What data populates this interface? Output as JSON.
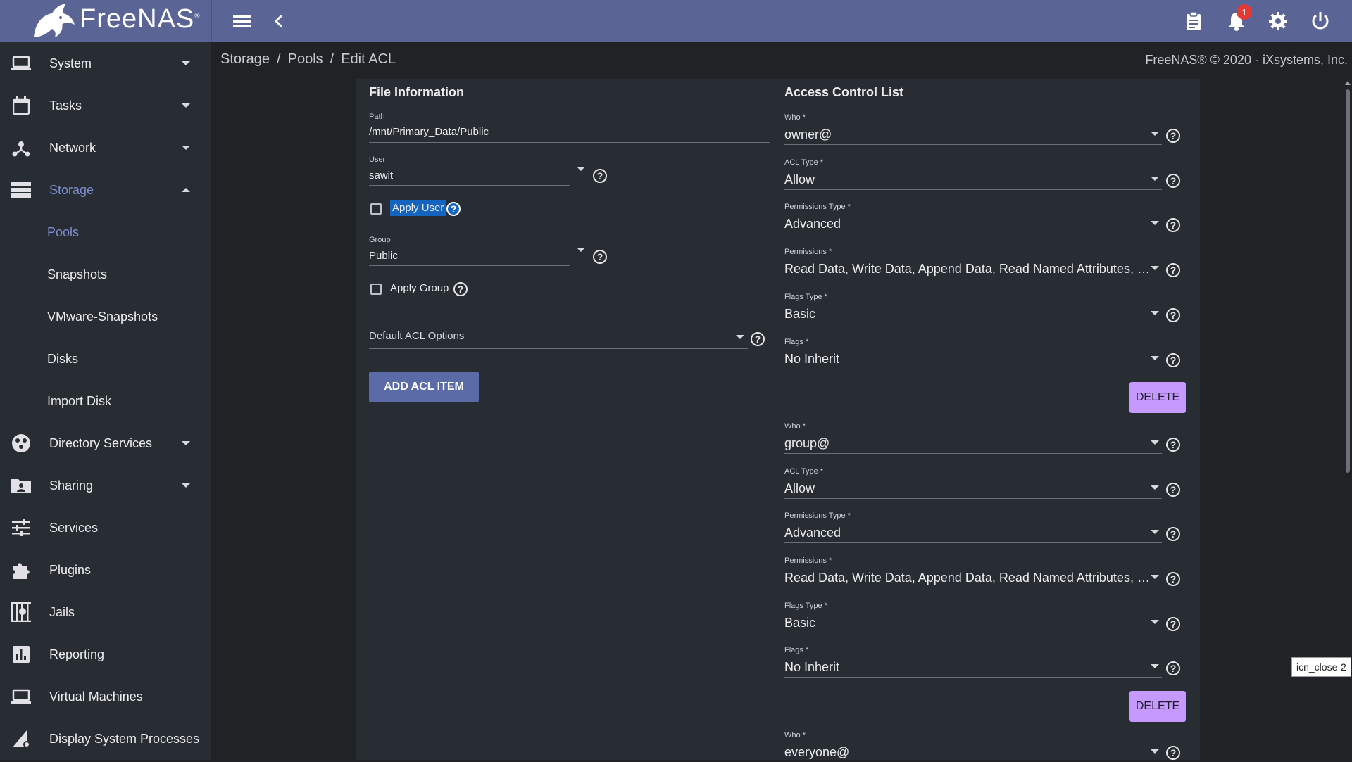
{
  "app": {
    "logo_text": "FreeNAS",
    "logo_tm": "®",
    "notification_count": "1"
  },
  "topbar": {
    "menu_icon": "hamburger-icon",
    "back_icon": "chevron-left-icon",
    "icons": [
      "clipboard-icon",
      "bell-icon",
      "gear-icon",
      "power-icon"
    ]
  },
  "sidebar": {
    "items": [
      {
        "label": "System",
        "icon": "laptop-icon",
        "expand": "down"
      },
      {
        "label": "Tasks",
        "icon": "calendar-icon",
        "expand": "down"
      },
      {
        "label": "Network",
        "icon": "network-icon",
        "expand": "down"
      },
      {
        "label": "Storage",
        "icon": "storage-icon",
        "expand": "up",
        "active": true
      },
      {
        "label": "Directory Services",
        "icon": "directory-icon",
        "expand": "down"
      },
      {
        "label": "Sharing",
        "icon": "sharing-icon",
        "expand": "down"
      },
      {
        "label": "Services",
        "icon": "tune-icon"
      },
      {
        "label": "Plugins",
        "icon": "puzzle-icon"
      },
      {
        "label": "Jails",
        "icon": "jail-icon"
      },
      {
        "label": "Reporting",
        "icon": "chart-icon"
      },
      {
        "label": "Virtual Machines",
        "icon": "monitor-icon"
      },
      {
        "label": "Display System Processes",
        "icon": "processes-icon"
      }
    ],
    "storage_sub": [
      "Pools",
      "Snapshots",
      "VMware-Snapshots",
      "Disks",
      "Import Disk"
    ]
  },
  "breadcrumb": {
    "items": [
      "Storage",
      "Pools",
      "Edit ACL"
    ],
    "separator": "/"
  },
  "copyright": "FreeNAS® © 2020 - iXsystems, Inc.",
  "file_info": {
    "title": "File Information",
    "path_label": "Path",
    "path_value": "/mnt/Primary_Data/Public",
    "user_label": "User",
    "user_value": "sawit",
    "apply_user_label": "Apply User",
    "group_label": "Group",
    "group_value": "Public",
    "apply_group_label": "Apply Group",
    "default_acl_label": "Default ACL Options",
    "add_button": "ADD ACL ITEM"
  },
  "acl": {
    "title": "Access Control List",
    "labels": {
      "who": "Who *",
      "acl_type": "ACL Type *",
      "perm_type": "Permissions Type *",
      "perms": "Permissions *",
      "flags_type": "Flags Type *",
      "flags": "Flags *"
    },
    "delete_label": "DELETE",
    "entries": [
      {
        "who": "owner@",
        "acl_type": "Allow",
        "perm_type": "Advanced",
        "perms": "Read Data, Write Data, Append Data, Read Named Attributes, Wri...",
        "flags_type": "Basic",
        "flags": "No Inherit"
      },
      {
        "who": "group@",
        "acl_type": "Allow",
        "perm_type": "Advanced",
        "perms": "Read Data, Write Data, Append Data, Read Named Attributes, Exe...",
        "flags_type": "Basic",
        "flags": "No Inherit"
      },
      {
        "who": "everyone@"
      }
    ]
  },
  "tooltip": "icn_close-2",
  "colors": {
    "topbar": "#5a6596",
    "sidebar": "#282c33",
    "background": "#212226",
    "active_nav": "#7e8ed1",
    "primary_button": "#5a6ba8",
    "delete_button": "#c599ff",
    "highlight": "#1565c0"
  }
}
